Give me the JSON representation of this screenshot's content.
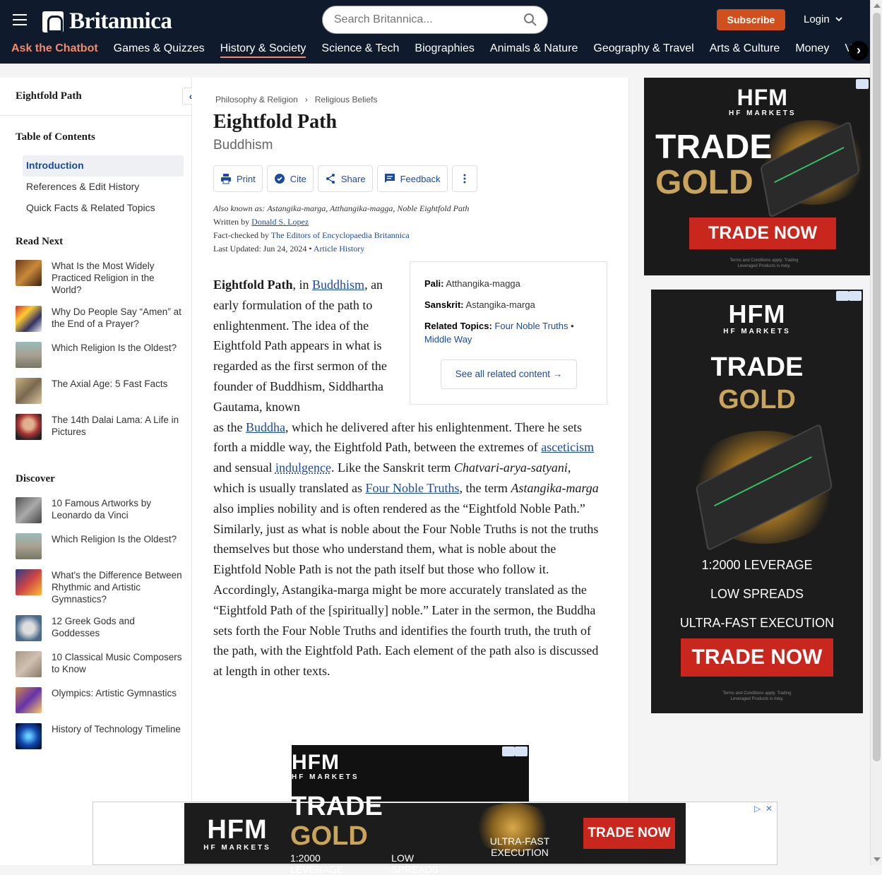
{
  "header": {
    "brand": "Britannica",
    "search_placeholder": "Search Britannica...",
    "subscribe": "Subscribe",
    "login": "Login",
    "nav": [
      "Ask the Chatbot",
      "Games & Quizzes",
      "History & Society",
      "Science & Tech",
      "Biographies",
      "Animals & Nature",
      "Geography & Travel",
      "Arts & Culture",
      "Money",
      "V"
    ],
    "active_nav": "History & Society",
    "accent": "#f38a6a"
  },
  "sidebar": {
    "title": "Eightfold Path",
    "toc_heading": "Table of Contents",
    "toc": [
      "Introduction",
      "References & Edit History",
      "Quick Facts & Related Topics"
    ],
    "read_next_heading": "Read Next",
    "read_next": [
      "What Is the Most Widely Practiced Religion in the World?",
      "Why Do People Say “Amen” at the End of a Prayer?",
      "Which Religion Is the Oldest?",
      "The Axial Age: 5 Fast Facts",
      "The 14th Dalai Lama: A Life in Pictures"
    ],
    "discover_heading": "Discover",
    "discover": [
      "10 Famous Artworks by Leonardo da Vinci",
      "Which Religion Is the Oldest?",
      "What's the Difference Between Rhythmic and Artistic Gymnastics?",
      "12 Greek Gods and Goddesses",
      "10 Classical Music Composers to Know",
      "Olympics: Artistic Gymnastics",
      "History of Technology Timeline"
    ]
  },
  "article": {
    "breadcrumbs": [
      "Philosophy & Religion",
      "Religious Beliefs"
    ],
    "title": "Eightfold Path",
    "subtitle": "Buddhism",
    "tools": [
      "Print",
      "Cite",
      "Share",
      "Feedback"
    ],
    "also_known_label": "Also known as:",
    "also_known": "Astangika-marga, Atthangika-magga, Noble Eightfold Path",
    "written_by_label": "Written by",
    "author": "Donald S. Lopez",
    "fact_checked_label": "Fact-checked by",
    "fact_checker": "The Editors of Encyclopaedia Britannica",
    "updated": "Last Updated: Jun 24, 2024",
    "history_link": "Article History",
    "infobox": {
      "pali_label": "Pali:",
      "pali": "Atthangika-magga",
      "sanskrit_label": "Sanskrit:",
      "sanskrit": "Astangika-marga",
      "related_label": "Related Topics:",
      "related_1": "Four Noble Truths",
      "related_2": "Middle Way",
      "button": "See all related content →"
    },
    "p_term": "Eightfold Path",
    "p_t1": ", in ",
    "p_link1": "Buddhism",
    "p_t2": ", an early formulation of the path to enlightenment. The idea of the Eightfold Path appears in what is regarded as the first sermon of the founder of Buddhism, Siddhartha Gautama, known",
    "p_t3": "as the ",
    "p_link2": "Buddha",
    "p_t4": ", which he delivered after his enlightenment. There he sets forth a middle way, the Eightfold Path, between the extremes of ",
    "p_link3": "asceticism",
    "p_t5": " and sensual ",
    "p_link4": "indulgence",
    "p_t6": ". Like the Sanskrit term ",
    "p_em1": "Chatvari-arya-satyani",
    "p_t7": ", which is usually translated as ",
    "p_link5": "Four Noble Truths",
    "p_t8": ", the term ",
    "p_em2": "Astangika-marga",
    "p_t9": " also implies nobility and is often rendered as the “Eightfold Noble Path.” Similarly, just as what is noble about the Four Noble Truths is not the truths themselves but those who understand them, what is noble about the Eightfold Noble Path is not the path itself but those who follow it. Accordingly, Astangika-marga might be more accurately translated as the “Eightfold Path of the [spiritually] noble.” Later in the sermon, the Buddha sets forth the Four Noble Truths and identifies the fourth truth, the truth of the path, with the Eightfold Path. Each element of the path also is discussed at length in other texts."
  },
  "ads": {
    "brand": "HFM",
    "brand_sub": "HF MARKETS",
    "trade": "TRADE",
    "gold": "GOLD",
    "cta": "TRADE NOW",
    "leverage": "1:2000 LEVERAGE",
    "spreads": "LOW SPREADS",
    "execution": "ULTRA-FAST EXECUTION",
    "terms": "Terms and Conditions apply. Trading Leveraged Products is risky."
  }
}
